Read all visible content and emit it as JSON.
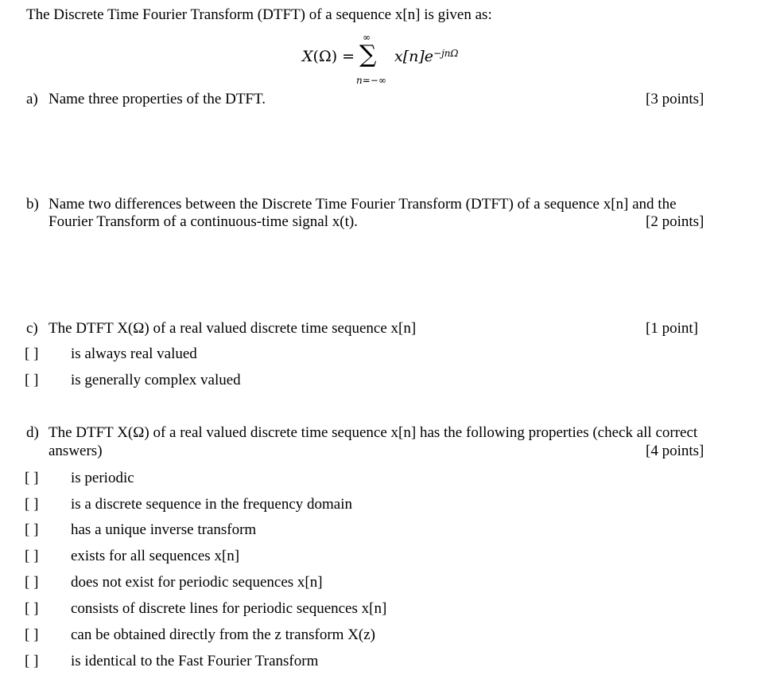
{
  "intro": "The Discrete Time Fourier Transform (DTFT) of a sequence x[n] is given as:",
  "formula": {
    "lhs_var": "X",
    "lhs_open": "(",
    "lhs_omega": "Ω",
    "lhs_close": ") =",
    "sum_symbol": "∑",
    "upper_limit": "∞",
    "lower_limit": "n=−∞",
    "rhs_base": "x[n]e",
    "rhs_exponent": "−jnΩ"
  },
  "questions": {
    "a": {
      "label": "a)",
      "text": "Name three properties of the DTFT.",
      "points": "[3 points]"
    },
    "b": {
      "label": "b)",
      "text_line1": "Name two differences between the Discrete Time Fourier Transform (DTFT) of a sequence x[n] and the",
      "text_line2": "Fourier Transform of a continuous-time signal x(t).",
      "points": "[2 points]"
    },
    "c": {
      "label": "c)",
      "text": "The DTFT X(Ω) of a real valued discrete time sequence x[n]",
      "points": "[1 point]",
      "options": [
        {
          "box": "[ ]",
          "text": "is always real valued"
        },
        {
          "box": "[ ]",
          "text": "is generally complex valued"
        }
      ]
    },
    "d": {
      "label": "d)",
      "text_line1": "The DTFT X(Ω) of a real valued discrete time sequence x[n] has the following properties (check all correct",
      "text_line2": "answers)",
      "points": "[4 points]",
      "options": [
        {
          "box": "[ ]",
          "text": "is periodic"
        },
        {
          "box": "[ ]",
          "text": "is a discrete sequence in the frequency domain"
        },
        {
          "box": "[ ]",
          "text": "has a unique inverse transform"
        },
        {
          "box": "[ ]",
          "text": "exists for all sequences x[n]"
        },
        {
          "box": "[ ]",
          "text": "does not exist for periodic sequences x[n]"
        },
        {
          "box": "[ ]",
          "text": "consists of discrete lines for periodic sequences x[n]"
        },
        {
          "box": "[ ]",
          "text": "can be obtained directly from the z transform X(z)"
        },
        {
          "box": "[ ]",
          "text": "is identical to the Fast Fourier Transform"
        }
      ]
    }
  }
}
